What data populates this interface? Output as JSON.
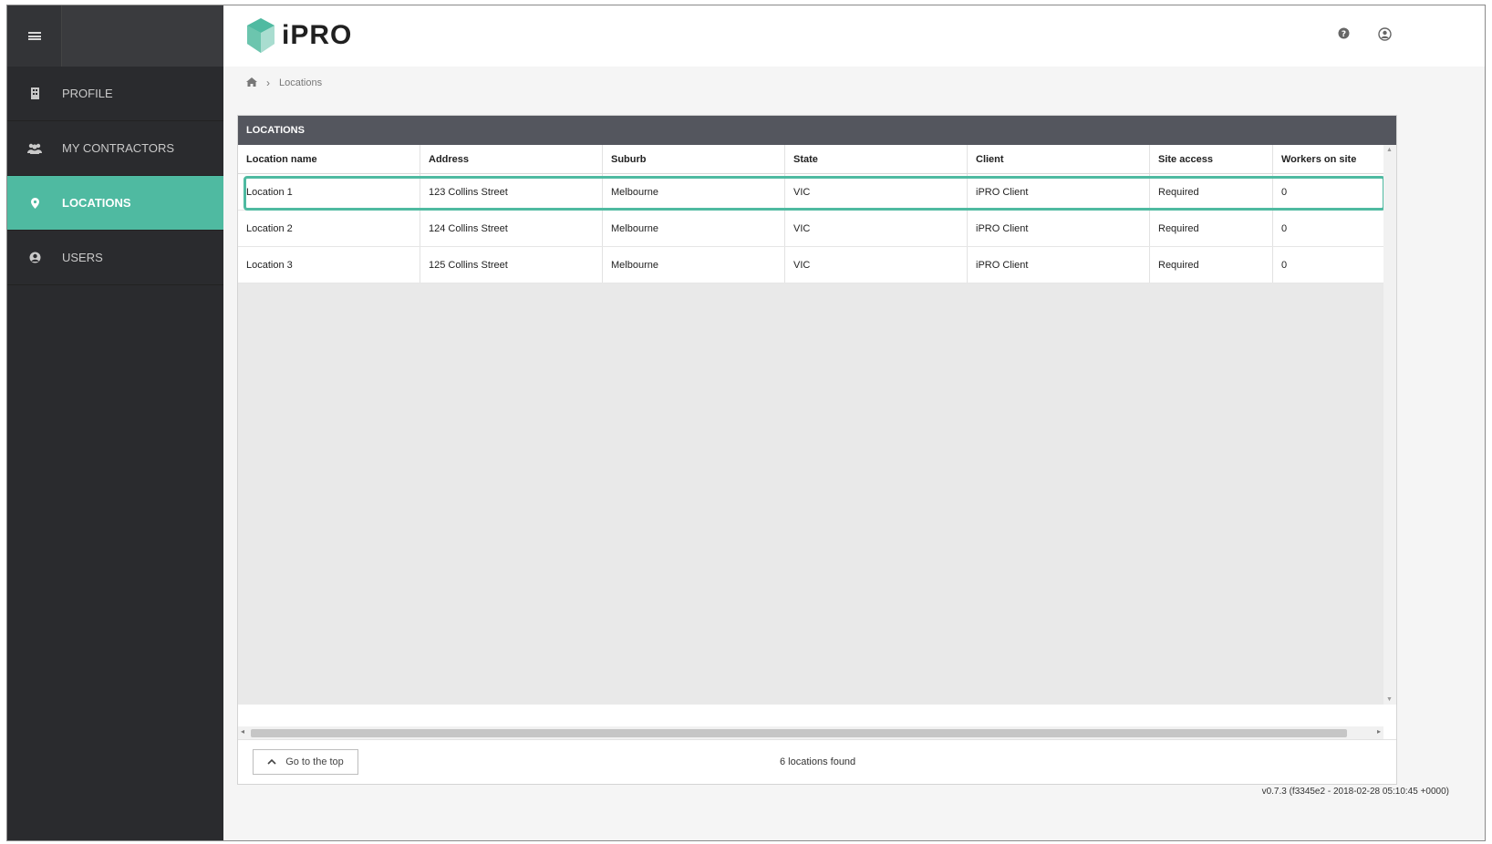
{
  "brand": {
    "name": "iPRO",
    "accent": "#4fbaa1"
  },
  "sidebar": {
    "items": [
      {
        "label": "PROFILE",
        "icon": "building-icon",
        "active": false
      },
      {
        "label": "MY CONTRACTORS",
        "icon": "users-group-icon",
        "active": false
      },
      {
        "label": "LOCATIONS",
        "icon": "map-pin-icon",
        "active": true
      },
      {
        "label": "USERS",
        "icon": "user-circle-icon",
        "active": false
      }
    ]
  },
  "header": {
    "help_icon": "help-icon",
    "account_icon": "account-icon"
  },
  "breadcrumb": {
    "home_icon": "home-icon",
    "current": "Locations"
  },
  "panel": {
    "title": "LOCATIONS",
    "columns": [
      "Location name",
      "Address",
      "Suburb",
      "State",
      "Client",
      "Site access",
      "Workers on site"
    ],
    "rows": [
      [
        "Location 1",
        "123 Collins Street",
        "Melbourne",
        "VIC",
        "iPRO Client",
        "Required",
        "0"
      ],
      [
        "Location 2",
        "124 Collins Street",
        "Melbourne",
        "VIC",
        "iPRO Client",
        "Required",
        "0"
      ],
      [
        "Location 3",
        "125 Collins Street",
        "Melbourne",
        "VIC",
        "iPRO Client",
        "Required",
        "0"
      ]
    ],
    "go_top_label": "Go to the top",
    "found_text": "6 locations found"
  },
  "version": "v0.7.3 (f3345e2 - 2018-02-28 05:10:45 +0000)"
}
